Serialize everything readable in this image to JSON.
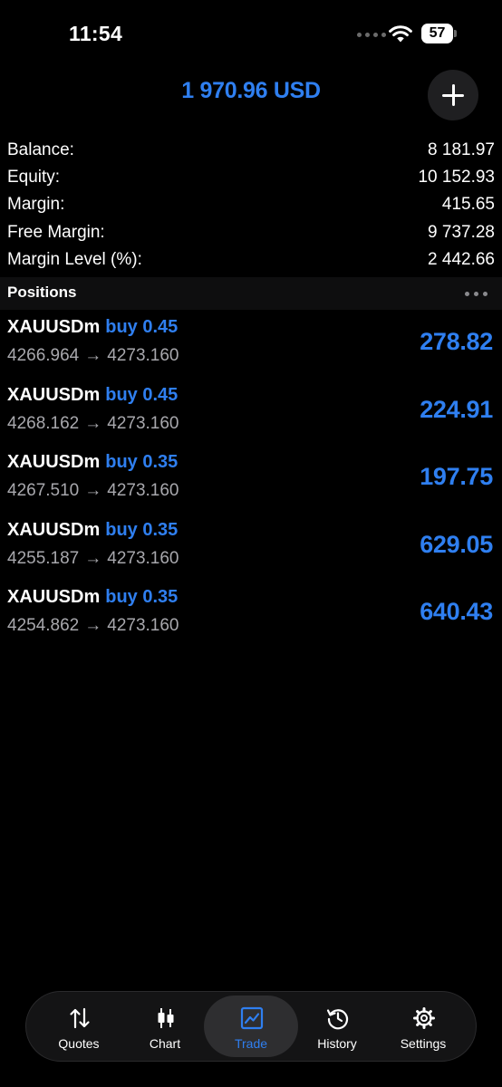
{
  "status_bar": {
    "time": "11:54",
    "battery": "57"
  },
  "header": {
    "title": "1 970.96 USD",
    "add_icon": "plus-icon"
  },
  "summary": [
    {
      "label": "Balance:",
      "value": "8 181.97"
    },
    {
      "label": "Equity:",
      "value": "10 152.93"
    },
    {
      "label": "Margin:",
      "value": "415.65"
    },
    {
      "label": "Free Margin:",
      "value": "9 737.28"
    },
    {
      "label": "Margin Level (%):",
      "value": "2 442.66"
    }
  ],
  "positions": {
    "title": "Positions",
    "items": [
      {
        "symbol": "XAUUSDm",
        "side": "buy 0.45",
        "open_price": "4266.964",
        "current_price": "4273.160",
        "profit": "278.82"
      },
      {
        "symbol": "XAUUSDm",
        "side": "buy 0.45",
        "open_price": "4268.162",
        "current_price": "4273.160",
        "profit": "224.91"
      },
      {
        "symbol": "XAUUSDm",
        "side": "buy 0.35",
        "open_price": "4267.510",
        "current_price": "4273.160",
        "profit": "197.75"
      },
      {
        "symbol": "XAUUSDm",
        "side": "buy 0.35",
        "open_price": "4255.187",
        "current_price": "4273.160",
        "profit": "629.05"
      },
      {
        "symbol": "XAUUSDm",
        "side": "buy 0.35",
        "open_price": "4254.862",
        "current_price": "4273.160",
        "profit": "640.43"
      }
    ],
    "arrow": "→"
  },
  "tabs": [
    {
      "label": "Quotes",
      "icon": "quotes-arrows-icon",
      "active": false
    },
    {
      "label": "Chart",
      "icon": "candlestick-icon",
      "active": false
    },
    {
      "label": "Trade",
      "icon": "trade-chart-icon",
      "active": true
    },
    {
      "label": "History",
      "icon": "history-clock-icon",
      "active": false
    },
    {
      "label": "Settings",
      "icon": "gear-icon",
      "active": false
    }
  ],
  "colors": {
    "accent": "#2f7ff0",
    "background": "#000000",
    "secondary_text": "#a8a8ad"
  }
}
